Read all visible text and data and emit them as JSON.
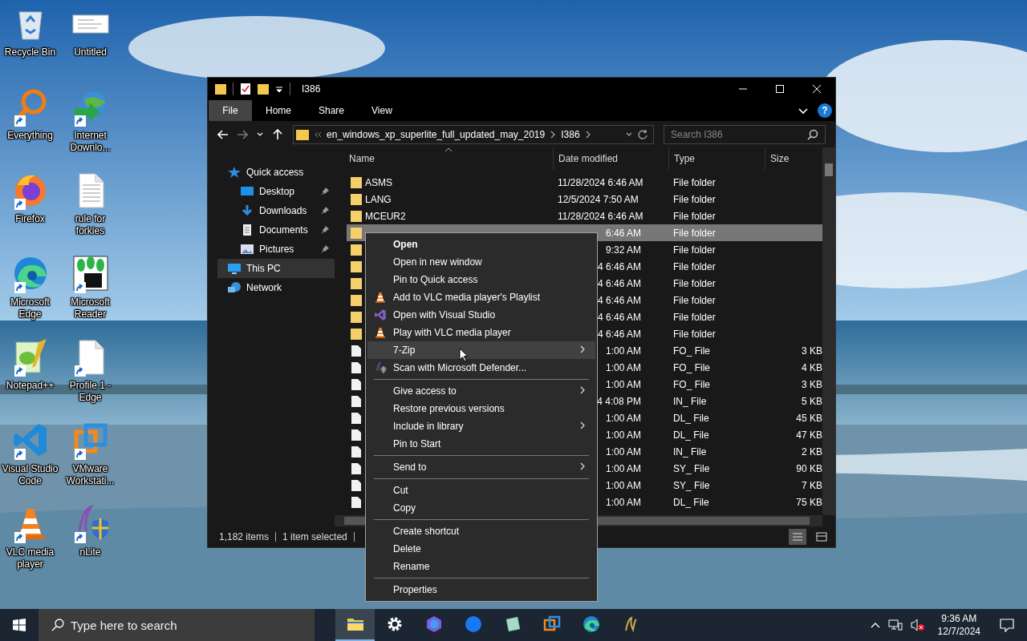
{
  "desktop_icons": [
    {
      "label": "Recycle Bin",
      "kind": "recycle",
      "shortcut": false
    },
    {
      "label": "Untitled",
      "kind": "thumb",
      "shortcut": false
    },
    {
      "label": "Everything",
      "kind": "magnifier",
      "shortcut": true
    },
    {
      "label": "Internet Downlo...",
      "kind": "globe",
      "shortcut": true
    },
    {
      "label": "Firefox",
      "kind": "flame",
      "shortcut": true
    },
    {
      "label": "rule for forkies",
      "kind": "textdoc",
      "shortcut": false
    },
    {
      "label": "Microsoft Edge",
      "kind": "swirl",
      "shortcut": true
    },
    {
      "label": "Microsoft Reader",
      "kind": "plant",
      "shortcut": true
    },
    {
      "label": "Notepad++",
      "kind": "notepad",
      "shortcut": true
    },
    {
      "label": "Profile 1 - Edge",
      "kind": "page",
      "shortcut": true
    },
    {
      "label": "Visual Studio Code",
      "kind": "ribbon",
      "shortcut": true
    },
    {
      "label": "VMware Workstati...",
      "kind": "squares",
      "shortcut": true
    },
    {
      "label": "VLC media player",
      "kind": "cone",
      "shortcut": true
    },
    {
      "label": "nLite",
      "kind": "shield",
      "shortcut": true
    }
  ],
  "explorer": {
    "title": "I386",
    "ribbon_tabs": [
      {
        "label": "File",
        "selected": true
      },
      {
        "label": "Home",
        "selected": false
      },
      {
        "label": "Share",
        "selected": false
      },
      {
        "label": "View",
        "selected": false
      }
    ],
    "help": "?",
    "address": [
      "en_windows_xp_superlite_full_updated_may_2019",
      "I386"
    ],
    "search": {
      "placeholder": "Search I386"
    },
    "nav": [
      {
        "label": "Quick access",
        "kind": "star",
        "selected": false,
        "children": [
          {
            "label": "Desktop",
            "kind": "desktop",
            "selected": false,
            "pinned": true
          },
          {
            "label": "Downloads",
            "kind": "download",
            "selected": false,
            "pinned": true
          },
          {
            "label": "Documents",
            "kind": "documents",
            "selected": false,
            "pinned": true
          },
          {
            "label": "Pictures",
            "kind": "pictures",
            "selected": false,
            "pinned": true
          }
        ]
      },
      {
        "label": "This PC",
        "kind": "pc",
        "selected": true
      },
      {
        "label": "Network",
        "kind": "network",
        "selected": false
      }
    ],
    "columns": [
      "Name",
      "Date modified",
      "Type",
      "Size"
    ],
    "rows": [
      {
        "kind": "folder",
        "name": "ASMS",
        "date": "11/28/2024 6:46 AM",
        "type": "File folder",
        "selected": false,
        "covered": false
      },
      {
        "kind": "folder",
        "name": "LANG",
        "date": "12/5/2024 7:50 AM",
        "type": "File folder",
        "selected": false,
        "covered": false
      },
      {
        "kind": "folder",
        "name": "MCEUR2",
        "date": "11/28/2024 6:46 AM",
        "type": "File folder",
        "selected": false,
        "covered": false
      },
      {
        "kind": "folder",
        "date": "6:46 AM",
        "type": "File folder",
        "selected": true,
        "covered": true
      },
      {
        "kind": "folder",
        "date": "9:32 AM",
        "type": "File folder",
        "selected": false,
        "covered": true
      },
      {
        "kind": "folder",
        "date": "4 6:46 AM",
        "type": "File folder",
        "selected": false,
        "covered": true
      },
      {
        "kind": "folder",
        "date": "4 6:46 AM",
        "type": "File folder",
        "selected": false,
        "covered": true
      },
      {
        "kind": "folder",
        "date": "4 6:46 AM",
        "type": "File folder",
        "selected": false,
        "covered": true
      },
      {
        "kind": "folder",
        "date": "4 6:46 AM",
        "type": "File folder",
        "selected": false,
        "covered": true
      },
      {
        "kind": "folder",
        "date": "4 6:46 AM",
        "type": "File folder",
        "selected": false,
        "covered": true
      },
      {
        "kind": "file",
        "date": "1:00 AM",
        "type": "FO_ File",
        "size": "3 KB",
        "selected": false,
        "covered": true
      },
      {
        "kind": "file",
        "date": "1:00 AM",
        "type": "FO_ File",
        "size": "4 KB",
        "selected": false,
        "covered": true
      },
      {
        "kind": "file",
        "date": "1:00 AM",
        "type": "FO_ File",
        "size": "3 KB",
        "selected": false,
        "covered": true
      },
      {
        "kind": "file",
        "date": "4 4:08 PM",
        "type": "IN_ File",
        "size": "5 KB",
        "selected": false,
        "covered": true
      },
      {
        "kind": "file",
        "date": "1:00 AM",
        "type": "DL_ File",
        "size": "45 KB",
        "selected": false,
        "covered": true
      },
      {
        "kind": "file",
        "date": "1:00 AM",
        "type": "DL_ File",
        "size": "47 KB",
        "selected": false,
        "covered": true
      },
      {
        "kind": "file",
        "date": "1:00 AM",
        "type": "IN_ File",
        "size": "2 KB",
        "selected": false,
        "covered": true
      },
      {
        "kind": "file",
        "date": "1:00 AM",
        "type": "SY_ File",
        "size": "90 KB",
        "selected": false,
        "covered": true
      },
      {
        "kind": "file",
        "date": "1:00 AM",
        "type": "SY_ File",
        "size": "7 KB",
        "selected": false,
        "covered": true
      },
      {
        "kind": "file",
        "date": "1:00 AM",
        "type": "DL_ File",
        "size": "75 KB",
        "selected": false,
        "covered": true
      }
    ],
    "status": {
      "count": "1,182 items",
      "selection": "1 item selected"
    },
    "views": [
      {
        "kind": "details",
        "selected": true
      },
      {
        "kind": "tiles",
        "selected": false
      }
    ]
  },
  "context_menu": [
    {
      "kind": "item",
      "label": "Open",
      "bold": true,
      "submenu": false,
      "selected": false
    },
    {
      "kind": "item",
      "label": "Open in new window",
      "bold": false,
      "submenu": false,
      "selected": false
    },
    {
      "kind": "item",
      "label": "Pin to Quick access",
      "bold": false,
      "submenu": false,
      "selected": false
    },
    {
      "kind": "item",
      "label": "Add to VLC media player's Playlist",
      "bold": false,
      "submenu": false,
      "selected": false
    },
    {
      "kind": "item",
      "label": "Open with Visual Studio",
      "bold": false,
      "submenu": false,
      "selected": false
    },
    {
      "kind": "item",
      "label": "Play with VLC media player",
      "bold": false,
      "submenu": false,
      "selected": false
    },
    {
      "kind": "item",
      "label": "7-Zip",
      "bold": false,
      "submenu": true,
      "selected": true
    },
    {
      "kind": "item",
      "label": "Scan with Microsoft Defender...",
      "bold": false,
      "submenu": false,
      "selected": false
    },
    {
      "kind": "separator"
    },
    {
      "kind": "item",
      "label": "Give access to",
      "bold": false,
      "submenu": true,
      "selected": false
    },
    {
      "kind": "item",
      "label": "Restore previous versions",
      "bold": false,
      "submenu": false,
      "selected": false
    },
    {
      "kind": "item",
      "label": "Include in library",
      "bold": false,
      "submenu": true,
      "selected": false
    },
    {
      "kind": "item",
      "label": "Pin to Start",
      "bold": false,
      "submenu": false,
      "selected": false
    },
    {
      "kind": "separator"
    },
    {
      "kind": "item",
      "label": "Send to",
      "bold": false,
      "submenu": true,
      "selected": false
    },
    {
      "kind": "separator"
    },
    {
      "kind": "item",
      "label": "Cut",
      "bold": false,
      "submenu": false,
      "selected": false
    },
    {
      "kind": "item",
      "label": "Copy",
      "bold": false,
      "submenu": false,
      "selected": false
    },
    {
      "kind": "separator"
    },
    {
      "kind": "item",
      "label": "Create shortcut",
      "bold": false,
      "submenu": false,
      "selected": false
    },
    {
      "kind": "item",
      "label": "Delete",
      "bold": false,
      "submenu": false,
      "selected": false
    },
    {
      "kind": "item",
      "label": "Rename",
      "bold": false,
      "submenu": false,
      "selected": false
    },
    {
      "kind": "separator"
    },
    {
      "kind": "item",
      "label": "Properties",
      "bold": false,
      "submenu": false,
      "selected": false
    }
  ],
  "taskbar": {
    "search": {
      "placeholder": "Type here to search"
    },
    "apps": [
      {
        "kind": "folder",
        "active": true
      },
      {
        "kind": "gear",
        "active": false
      },
      {
        "kind": "hexagon",
        "active": false
      },
      {
        "kind": "circle",
        "active": false
      },
      {
        "kind": "sheet",
        "active": false
      },
      {
        "kind": "squares",
        "active": false
      },
      {
        "kind": "swirl",
        "active": false
      },
      {
        "kind": "curve",
        "active": false
      }
    ],
    "time": "9:36 AM",
    "date": "12/7/2024"
  }
}
